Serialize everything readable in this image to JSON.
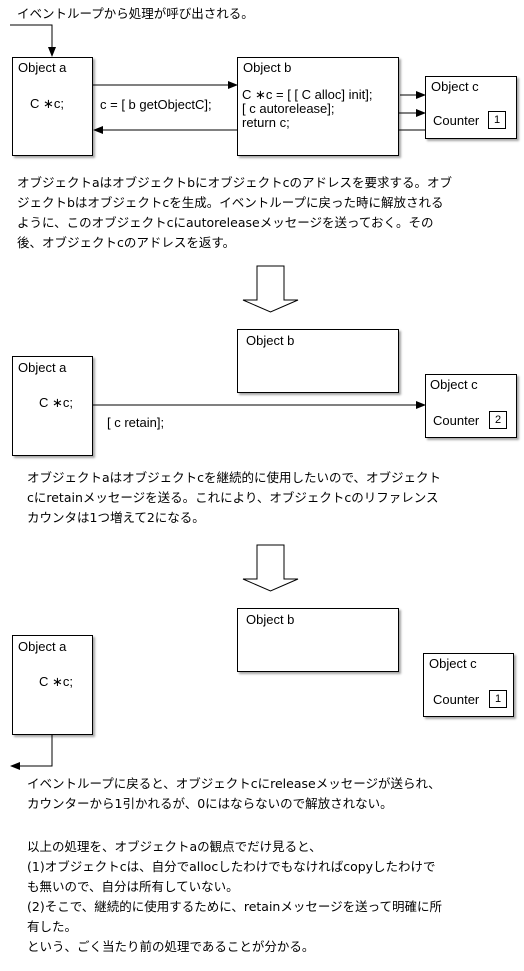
{
  "intro": "イベントループから処理が呼び出される。",
  "panel1": {
    "object_a": {
      "title": "Object a",
      "decl": "C ∗c;"
    },
    "call_label": "c = [ b getObjectC];",
    "object_b": {
      "title": "Object b",
      "lines": [
        "C ∗c = [ [ C alloc] init];",
        "[ c autorelease];",
        "return c;"
      ]
    },
    "object_c": {
      "title": "Object c",
      "counter_label": "Counter",
      "counter_value": "1"
    },
    "paragraph": [
      "オブジェクトaはオブジェクトbにオブジェクトcのアドレスを要求する。オブ",
      "ジェクトbはオブジェクトcを生成。イベントループに戻った時に解放される",
      "ように、このオブジェクトcにautoreleaseメッセージを送っておく。その",
      "後、オブジェクトcのアドレスを返す。"
    ]
  },
  "panel2": {
    "object_a": {
      "title": "Object a",
      "decl": "C ∗c;"
    },
    "object_b": {
      "title": "Object b"
    },
    "call_label": "[ c retain];",
    "object_c": {
      "title": "Object c",
      "counter_label": "Counter",
      "counter_value": "2"
    },
    "paragraph": [
      "オブジェクトaはオブジェクトcを継続的に使用したいので、オブジェクト",
      "cにretainメッセージを送る。これにより、オブジェクトcのリファレンス",
      "カウンタは1つ増えて2になる。"
    ]
  },
  "panel3": {
    "object_a": {
      "title": "Object a",
      "decl": "C ∗c;"
    },
    "object_b": {
      "title": "Object b"
    },
    "object_c": {
      "title": "Object c",
      "counter_label": "Counter",
      "counter_value": "1"
    },
    "paragraph": [
      "イベントループに戻ると、オブジェクトcにreleaseメッセージが送られ、",
      "カウンターから1引かれるが、0にはならないので解放されない。"
    ],
    "summary": [
      "以上の処理を、オブジェクトaの観点でだけ見ると、",
      "(1)オブジェクトcは、自分でallocしたわけでもなければcopyしたわけで",
      "も無いので、自分は所有していない。",
      "(2)そこで、継続的に使用するために、retainメッセージを送って明確に所",
      "有した。",
      "という、ごく当たり前の処理であることが分かる。"
    ]
  }
}
